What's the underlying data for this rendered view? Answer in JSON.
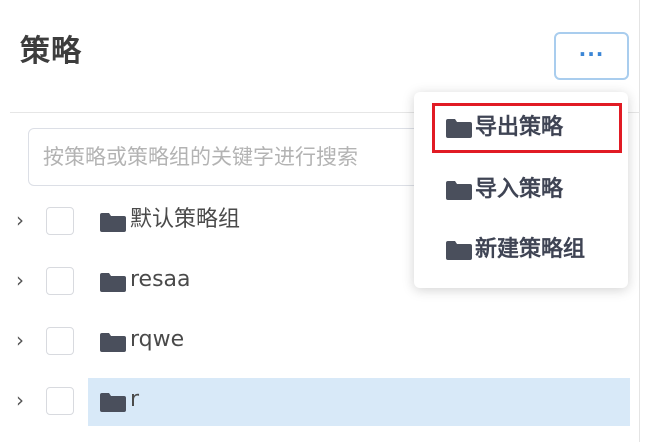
{
  "header": {
    "title": "策略",
    "more_label": "···"
  },
  "search": {
    "placeholder": "按策略或策略组的关键字进行搜索"
  },
  "tree": {
    "items": [
      {
        "label": "默认策略组",
        "selected": false
      },
      {
        "label": "resaa",
        "selected": false
      },
      {
        "label": "rqwe",
        "selected": false
      },
      {
        "label": "r",
        "selected": true
      }
    ],
    "expand_icon": "chevron-right-icon",
    "item_icon": "folder-icon"
  },
  "dropdown": {
    "items": [
      {
        "label": "导出策略",
        "highlighted": true
      },
      {
        "label": "导入策略",
        "highlighted": false
      },
      {
        "label": "新建策略组",
        "highlighted": false
      }
    ],
    "item_icon": "folder-icon"
  },
  "colors": {
    "accent": "#3b86d6",
    "selected_row": "#d8e9f8",
    "highlight_border": "#e11b24",
    "folder": "#4a4f5c"
  }
}
